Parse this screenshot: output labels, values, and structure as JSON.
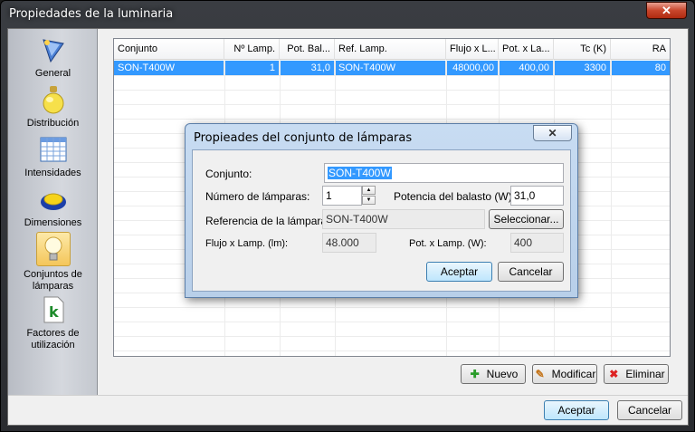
{
  "window": {
    "title": "Propiedades de la luminaria",
    "close_glyph": "✕"
  },
  "sidebar": {
    "items": [
      {
        "label": "General",
        "icon": "general-icon"
      },
      {
        "label": "Distribución",
        "icon": "distribution-icon"
      },
      {
        "label": "Intensidades",
        "icon": "intensities-grid-icon"
      },
      {
        "label": "Dimensiones",
        "icon": "dimensions-icon"
      },
      {
        "label": "Conjuntos de lámparas",
        "icon": "lightbulb-icon"
      },
      {
        "label": "Factores de utilización",
        "icon": "k-factor-icon"
      }
    ]
  },
  "table": {
    "headers": [
      "Conjunto",
      "Nº Lamp.",
      "Pot. Bal...",
      "Ref. Lamp.",
      "Flujo x L...",
      "Pot. x La...",
      "Tc (K)",
      "RA"
    ],
    "rows": [
      [
        "SON-T400W",
        "1",
        "31,0",
        "SON-T400W",
        "48000,00",
        "400,00",
        "3300",
        "80"
      ]
    ]
  },
  "actions": {
    "new": "Nuevo",
    "modify": "Modificar",
    "delete": "Eliminar"
  },
  "footer": {
    "ok": "Aceptar",
    "cancel": "Cancelar"
  },
  "dialog": {
    "title": "Propieades del conjunto de lámparas",
    "close_glyph": "✕",
    "set_label": "Conjunto:",
    "set_value": "SON-T400W",
    "num_lamps_label": "Número de lámparas:",
    "num_lamps_value": "1",
    "ballast_label": "Potencia del balasto (W):",
    "ballast_value": "31,0",
    "lamp_ref_label": "Referencia de la lámpara:",
    "lamp_ref_value": "SON-T400W",
    "select_button": "Seleccionar...",
    "flux_label": "Flujo x Lamp. (lm):",
    "flux_value": "48.000",
    "power_label": "Pot. x Lamp. (W):",
    "power_value": "400",
    "ok": "Aceptar",
    "cancel": "Cancelar"
  },
  "colors": {
    "selection": "#3399ff",
    "close_red": "#c9462c",
    "dialog_frame": "#b8cfe9"
  }
}
